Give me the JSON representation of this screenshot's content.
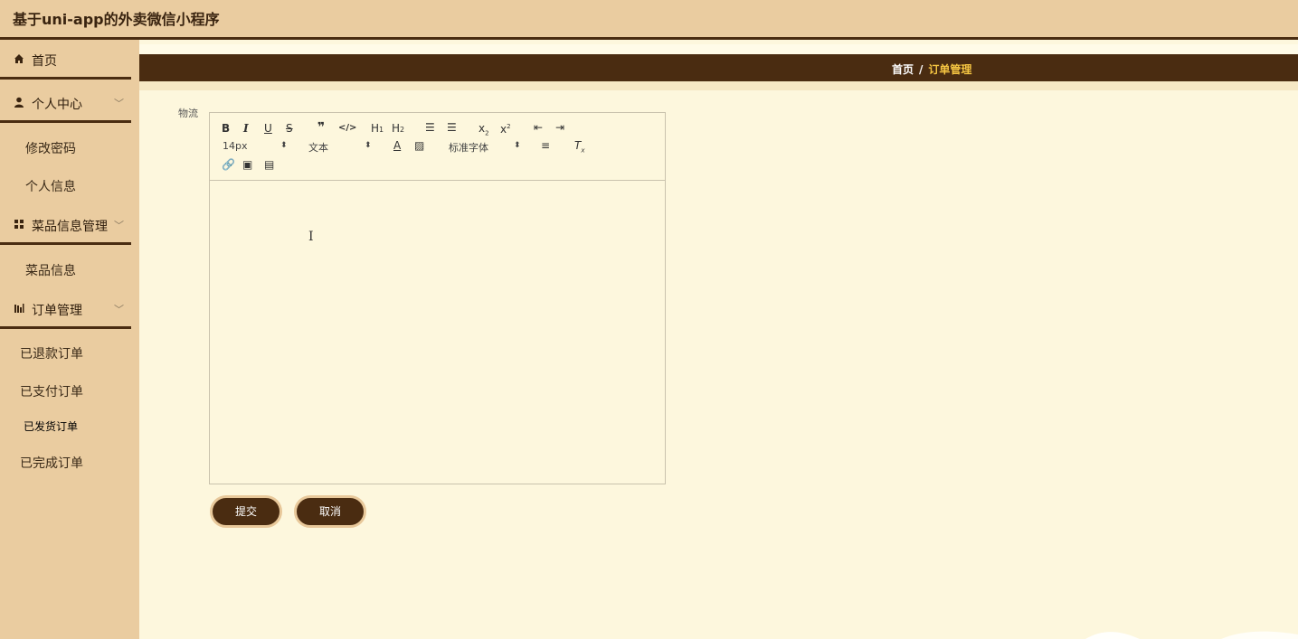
{
  "app": {
    "title": "基于uni-app的外卖微信小程序"
  },
  "sidebar": {
    "home": "首页",
    "personal": {
      "label": "个人中心",
      "items": [
        "修改密码",
        "个人信息"
      ]
    },
    "dishes": {
      "label": "菜品信息管理",
      "items": [
        "菜品信息"
      ]
    },
    "orders": {
      "label": "订单管理",
      "items": [
        "已退款订单",
        "已支付订单",
        "已发货订单",
        "已完成订单"
      ]
    }
  },
  "breadcrumb": {
    "home": "首页",
    "separator": "/",
    "current": "订单管理"
  },
  "form": {
    "field_label": "物流",
    "editor": {
      "font_size": "14px",
      "block_format": "文本",
      "font_family": "标准字体",
      "content": ""
    },
    "submit_label": "提交",
    "cancel_label": "取消"
  },
  "colors": {
    "primary": "#4a2c11",
    "sidebar_bg": "#eacca0",
    "page_bg": "#fdf7dd",
    "accent": "#f5c542"
  }
}
